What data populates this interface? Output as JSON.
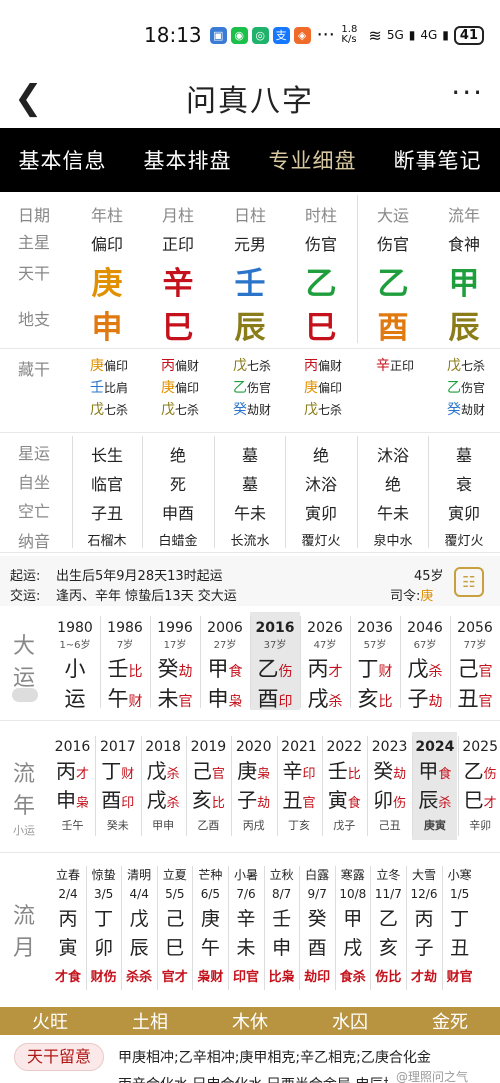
{
  "status": {
    "time": "18:13",
    "net_speed": "1.8 K/s",
    "signal1": "5G",
    "signal2": "4G",
    "battery": "41"
  },
  "title": "问真八字",
  "tabs": [
    "基本信息",
    "基本排盘",
    "专业细盘",
    "断事笔记"
  ],
  "row_labels": {
    "date": "日期",
    "main_star": "主星",
    "tiangan": "天干",
    "dizhi": "地支",
    "canggan": "藏干",
    "xingyun": "星运",
    "zizuo": "自坐",
    "kongwang": "空亡",
    "nayin": "纳音"
  },
  "columns": [
    {
      "head": "年柱",
      "star": "偏印",
      "gan": "庚",
      "zhi": "申",
      "cang": [
        [
          "庚",
          "偏印"
        ],
        [
          "壬",
          "比肩"
        ],
        [
          "戊",
          "七杀"
        ]
      ],
      "xingyun": "长生",
      "zizuo": "临官",
      "kong": "子丑",
      "nayin": "石榴木"
    },
    {
      "head": "月柱",
      "star": "正印",
      "gan": "辛",
      "zhi": "巳",
      "cang": [
        [
          "丙",
          "偏财"
        ],
        [
          "庚",
          "偏印"
        ],
        [
          "戊",
          "七杀"
        ]
      ],
      "xingyun": "绝",
      "zizuo": "死",
      "kong": "申酉",
      "nayin": "白蜡金"
    },
    {
      "head": "日柱",
      "star": "元男",
      "gan": "壬",
      "zhi": "辰",
      "cang": [
        [
          "戊",
          "七杀"
        ],
        [
          "乙",
          "伤官"
        ],
        [
          "癸",
          "劫财"
        ]
      ],
      "xingyun": "墓",
      "zizuo": "墓",
      "kong": "午未",
      "nayin": "长流水"
    },
    {
      "head": "时柱",
      "star": "伤官",
      "gan": "乙",
      "zhi": "巳",
      "cang": [
        [
          "丙",
          "偏财"
        ],
        [
          "庚",
          "偏印"
        ],
        [
          "戊",
          "七杀"
        ]
      ],
      "xingyun": "绝",
      "zizuo": "沐浴",
      "kong": "寅卯",
      "nayin": "覆灯火"
    },
    {
      "head": "大运",
      "star": "伤官",
      "gan": "乙",
      "zhi": "酉",
      "cang": [
        [
          "辛",
          "正印"
        ]
      ],
      "xingyun": "沐浴",
      "zizuo": "绝",
      "kong": "午未",
      "nayin": "泉中水"
    },
    {
      "head": "流年",
      "star": "食神",
      "gan": "甲",
      "zhi": "辰",
      "cang": [
        [
          "戊",
          "七杀"
        ],
        [
          "乙",
          "伤官"
        ],
        [
          "癸",
          "劫财"
        ]
      ],
      "xingyun": "墓",
      "zizuo": "衰",
      "kong": "寅卯",
      "nayin": "覆灯火"
    }
  ],
  "qiyun": {
    "label1": "起运:",
    "text1": "出生后5年9月28天13时起运",
    "age": "45岁",
    "label2": "交运:",
    "text2": "逢丙、辛年 惊蛰后13天 交大运",
    "siling_label": "司令:",
    "siling": "庚"
  },
  "dayun": {
    "label": "大运",
    "items": [
      {
        "year": "1980",
        "age": "1~6岁",
        "g": "小",
        "gs": "",
        "z": "运",
        "zs": ""
      },
      {
        "year": "1986",
        "age": "7岁",
        "g": "壬",
        "gs": "比",
        "z": "午",
        "zs": "财"
      },
      {
        "year": "1996",
        "age": "17岁",
        "g": "癸",
        "gs": "劫",
        "z": "未",
        "zs": "官"
      },
      {
        "year": "2006",
        "age": "27岁",
        "g": "甲",
        "gs": "食",
        "z": "申",
        "zs": "枭"
      },
      {
        "year": "2016",
        "age": "37岁",
        "g": "乙",
        "gs": "伤",
        "z": "酉",
        "zs": "印"
      },
      {
        "year": "2026",
        "age": "47岁",
        "g": "丙",
        "gs": "才",
        "z": "戌",
        "zs": "杀"
      },
      {
        "year": "2036",
        "age": "57岁",
        "g": "丁",
        "gs": "财",
        "z": "亥",
        "zs": "比"
      },
      {
        "year": "2046",
        "age": "67岁",
        "g": "戊",
        "gs": "杀",
        "z": "子",
        "zs": "劫"
      },
      {
        "year": "2056",
        "age": "77岁",
        "g": "己",
        "gs": "官",
        "z": "丑",
        "zs": "官"
      }
    ]
  },
  "liunian": {
    "label": "流年",
    "sub": "小运",
    "items": [
      {
        "year": "2016",
        "g": "丙",
        "gs": "才",
        "z": "申",
        "zs": "枭",
        "xy": "壬午"
      },
      {
        "year": "2017",
        "g": "丁",
        "gs": "财",
        "z": "酉",
        "zs": "印",
        "xy": "癸未"
      },
      {
        "year": "2018",
        "g": "戊",
        "gs": "杀",
        "z": "戌",
        "zs": "杀",
        "xy": "甲申"
      },
      {
        "year": "2019",
        "g": "己",
        "gs": "官",
        "z": "亥",
        "zs": "比",
        "xy": "乙酉"
      },
      {
        "year": "2020",
        "g": "庚",
        "gs": "枭",
        "z": "子",
        "zs": "劫",
        "xy": "丙戌"
      },
      {
        "year": "2021",
        "g": "辛",
        "gs": "印",
        "z": "丑",
        "zs": "官",
        "xy": "丁亥"
      },
      {
        "year": "2022",
        "g": "壬",
        "gs": "比",
        "z": "寅",
        "zs": "食",
        "xy": "戊子"
      },
      {
        "year": "2023",
        "g": "癸",
        "gs": "劫",
        "z": "卯",
        "zs": "伤",
        "xy": "己丑"
      },
      {
        "year": "2024",
        "g": "甲",
        "gs": "食",
        "z": "辰",
        "zs": "杀",
        "xy": "庚寅"
      },
      {
        "year": "2025",
        "g": "乙",
        "gs": "伤",
        "z": "巳",
        "zs": "才",
        "xy": "辛卯"
      }
    ]
  },
  "liuyue": {
    "label": "流月",
    "items": [
      {
        "jq": "立春",
        "d": "2/4",
        "g": "丙",
        "z": "寅",
        "s": "才食"
      },
      {
        "jq": "惊蛰",
        "d": "3/5",
        "g": "丁",
        "z": "卯",
        "s": "财伤"
      },
      {
        "jq": "清明",
        "d": "4/4",
        "g": "戊",
        "z": "辰",
        "s": "杀杀"
      },
      {
        "jq": "立夏",
        "d": "5/5",
        "g": "己",
        "z": "巳",
        "s": "官才"
      },
      {
        "jq": "芒种",
        "d": "6/5",
        "g": "庚",
        "z": "午",
        "s": "枭财"
      },
      {
        "jq": "小暑",
        "d": "7/6",
        "g": "辛",
        "z": "未",
        "s": "印官"
      },
      {
        "jq": "立秋",
        "d": "8/7",
        "g": "壬",
        "z": "申",
        "s": "比枭"
      },
      {
        "jq": "白露",
        "d": "9/7",
        "g": "癸",
        "z": "酉",
        "s": "劫印"
      },
      {
        "jq": "寒露",
        "d": "10/8",
        "g": "甲",
        "z": "戌",
        "s": "食杀"
      },
      {
        "jq": "立冬",
        "d": "11/7",
        "g": "乙",
        "z": "亥",
        "s": "伤比"
      },
      {
        "jq": "大雪",
        "d": "12/6",
        "g": "丙",
        "z": "子",
        "s": "才劫"
      },
      {
        "jq": "小寒",
        "d": "1/5",
        "g": "丁",
        "z": "丑",
        "s": "财官"
      }
    ]
  },
  "wuxing": [
    "火旺",
    "土相",
    "木休",
    "水囚",
    "金死"
  ],
  "tiangan_note": {
    "label": "天干留意",
    "text": "甲庚相冲;乙辛相冲;庚甲相克;辛乙相克;乙庚合化金"
  },
  "footer": {
    "text": "丙辛合化水,巳申合化水,巳酉半合金局,申辰拱合水局",
    "watermark": "@理照问之气"
  }
}
